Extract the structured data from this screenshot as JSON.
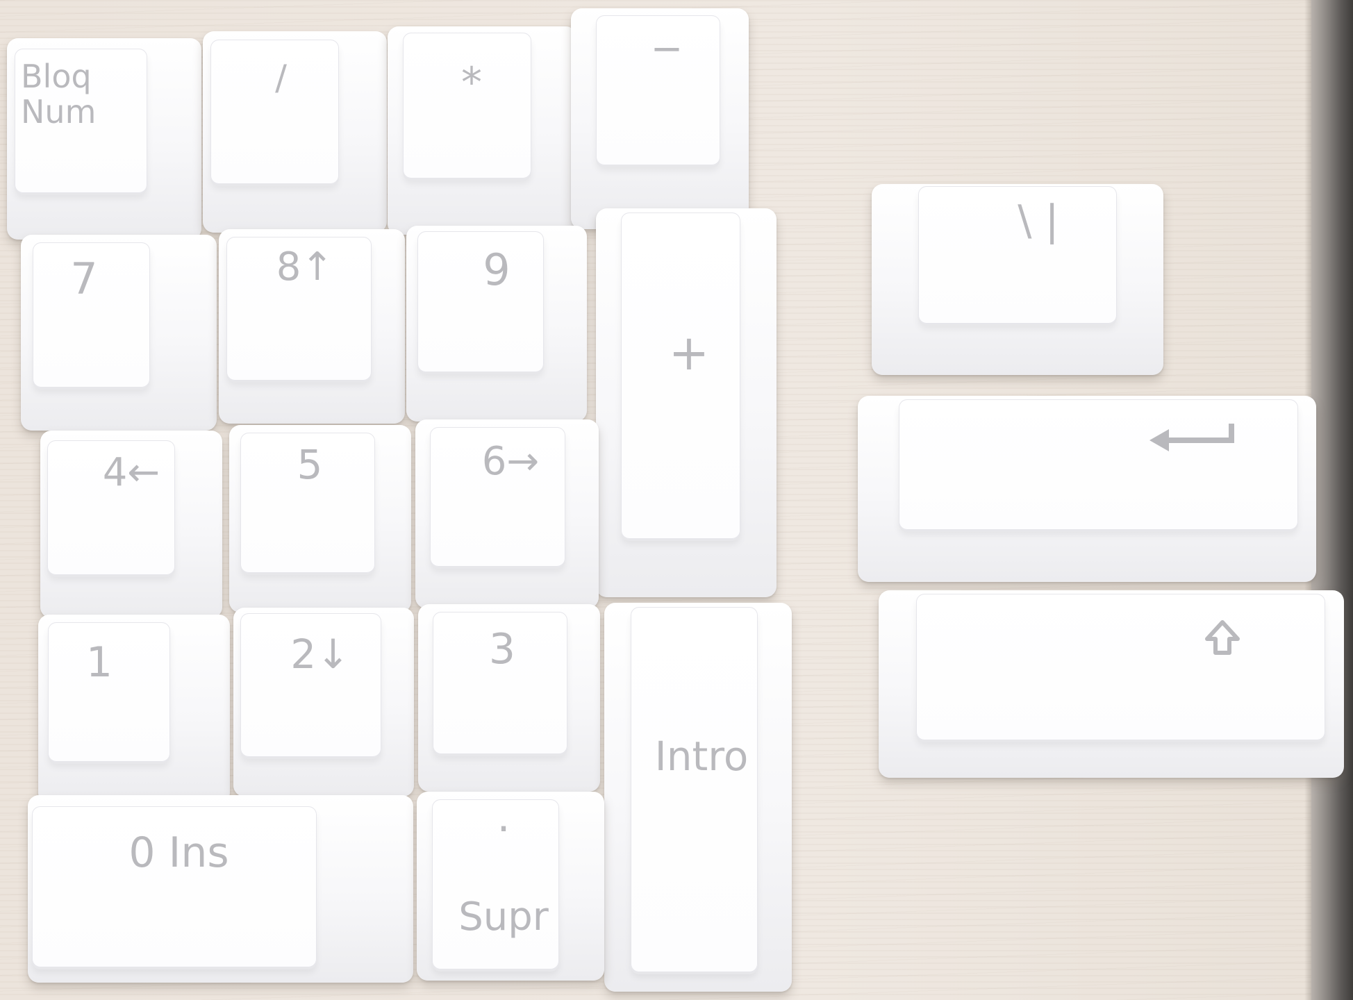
{
  "numpad": {
    "bloq_num": "Bloq\nNum",
    "slash": "/",
    "asterisk": "*",
    "minus": "−",
    "seven": "7",
    "eight": "8↑",
    "nine": "9",
    "plus": "+",
    "four": "4←",
    "five": "5",
    "six": "6→",
    "one": "1",
    "two": "2↓",
    "three": "3",
    "intro": "Intro",
    "ins": "0 Ins",
    "supr_dot": ".",
    "supr": "Supr"
  },
  "extra_keys": {
    "backslash_pipe": "\\  |",
    "enter_icon": "enter-arrow-icon",
    "shift_icon": "shift-arrow-icon"
  }
}
